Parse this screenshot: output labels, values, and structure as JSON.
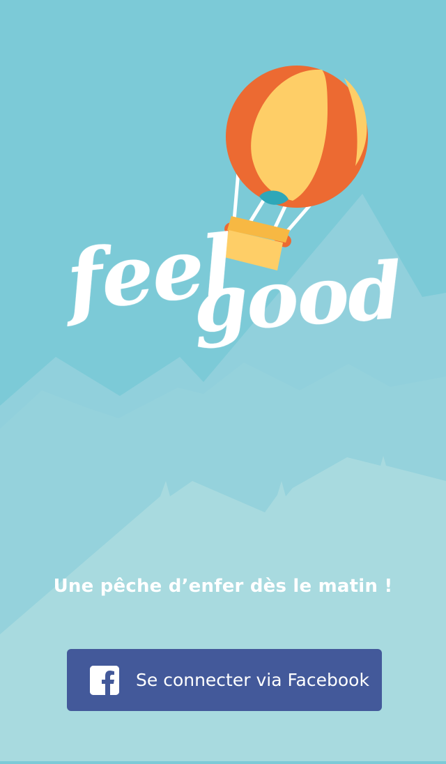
{
  "app": {
    "logo_text_line1": "feel",
    "logo_text_line2": "good",
    "tagline": "Une pêche d’enfer dès le matin !"
  },
  "login": {
    "facebook_button_label": "Se connecter via Facebook",
    "facebook_icon": "facebook-icon"
  },
  "colors": {
    "sky": "#7ccad7",
    "mountain_back": "#91d0dc",
    "mountain_mid": "#99d3dc",
    "mountain_front": "#a8dadf",
    "balloon_orange": "#ec6a32",
    "balloon_yellow": "#fece67",
    "facebook_blue": "#43599a",
    "text": "#ffffff"
  }
}
